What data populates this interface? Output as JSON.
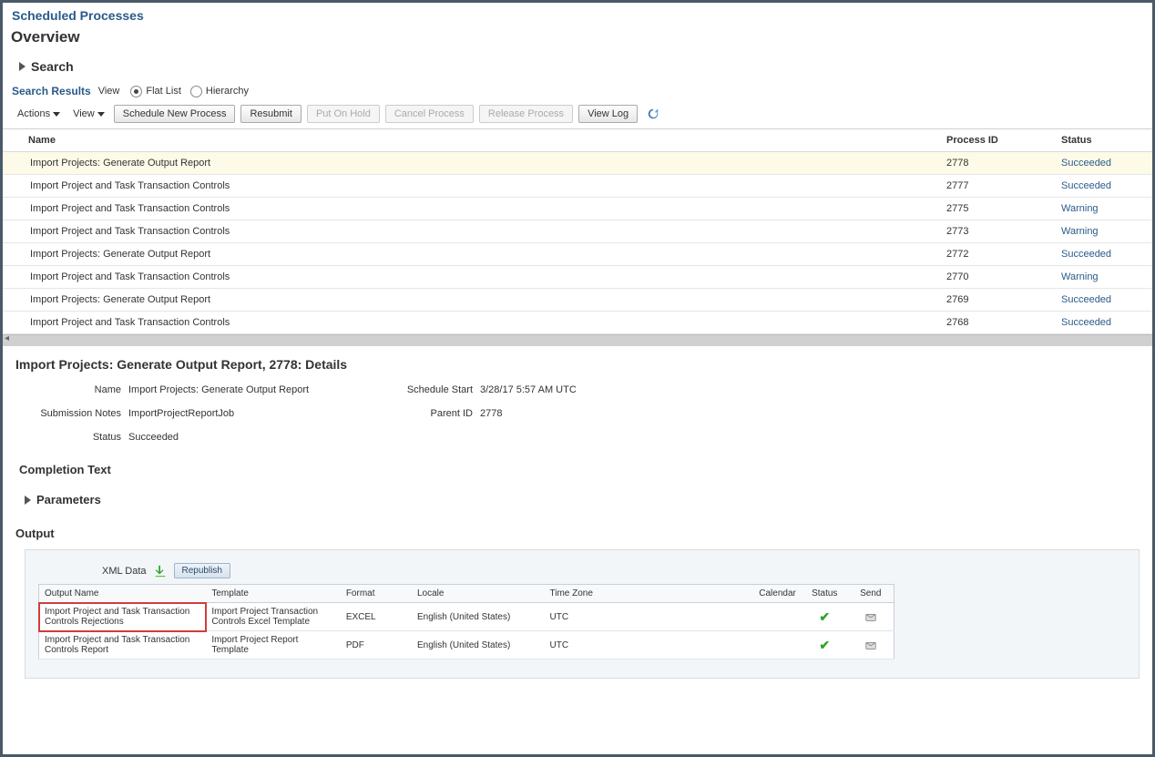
{
  "page_title": "Scheduled Processes",
  "overview": "Overview",
  "search_disclosure": "Search",
  "search_results_label": "Search Results",
  "view_label": "View",
  "view_options": {
    "flat": "Flat List",
    "hier": "Hierarchy"
  },
  "menus": {
    "actions": "Actions",
    "view": "View"
  },
  "buttons": {
    "schedule": "Schedule New Process",
    "resubmit": "Resubmit",
    "hold": "Put On Hold",
    "cancel": "Cancel Process",
    "release": "Release Process",
    "viewlog": "View Log"
  },
  "columns": {
    "name": "Name",
    "pid": "Process ID",
    "status": "Status"
  },
  "rows": [
    {
      "name": "Import Projects: Generate Output Report",
      "pid": "2778",
      "status": "Succeeded",
      "selected": true
    },
    {
      "name": "Import Project and Task Transaction Controls",
      "pid": "2777",
      "status": "Succeeded"
    },
    {
      "name": "Import Project and Task Transaction Controls",
      "pid": "2775",
      "status": "Warning"
    },
    {
      "name": "Import Project and Task Transaction Controls",
      "pid": "2773",
      "status": "Warning"
    },
    {
      "name": "Import Projects: Generate Output Report",
      "pid": "2772",
      "status": "Succeeded"
    },
    {
      "name": "Import Project and Task Transaction Controls",
      "pid": "2770",
      "status": "Warning"
    },
    {
      "name": "Import Projects: Generate Output Report",
      "pid": "2769",
      "status": "Succeeded"
    },
    {
      "name": "Import Project and Task Transaction Controls",
      "pid": "2768",
      "status": "Succeeded"
    }
  ],
  "details": {
    "title": "Import Projects: Generate Output Report, 2778: Details",
    "fields": {
      "name_k": "Name",
      "name_v": "Import Projects: Generate Output Report",
      "sched_k": "Schedule Start",
      "sched_v": "3/28/17 5:57 AM UTC",
      "notes_k": "Submission Notes",
      "notes_v": "ImportProjectReportJob",
      "parent_k": "Parent ID",
      "parent_v": "2778",
      "status_k": "Status",
      "status_v": "Succeeded"
    }
  },
  "completion_text": "Completion Text",
  "parameters": "Parameters",
  "output_label": "Output",
  "output": {
    "xml_label": "XML Data",
    "republish": "Republish",
    "cols": {
      "name": "Output Name",
      "tmpl": "Template",
      "fmt": "Format",
      "loc": "Locale",
      "tz": "Time Zone",
      "cal": "Calendar",
      "status": "Status",
      "send": "Send"
    },
    "rows": [
      {
        "name": "Import Project and Task Transaction Controls Rejections",
        "tmpl": "Import Project Transaction Controls Excel Template",
        "fmt": "EXCEL",
        "loc": "English (United States)",
        "tz": "UTC",
        "highlight": true
      },
      {
        "name": "Import Project and Task Transaction Controls Report",
        "tmpl": "Import Project Report Template",
        "fmt": "PDF",
        "loc": "English (United States)",
        "tz": "UTC"
      }
    ]
  }
}
